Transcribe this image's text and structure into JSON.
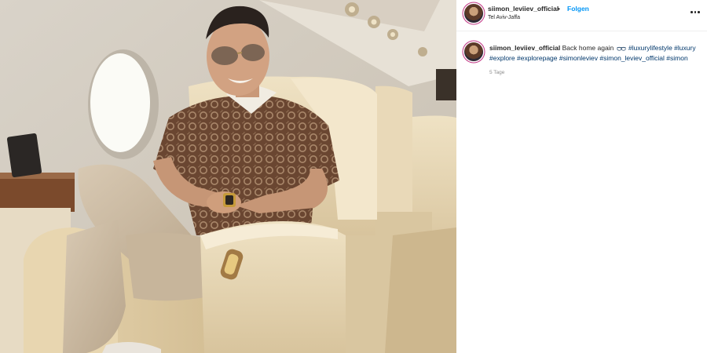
{
  "post": {
    "username": "siimon_leviiev_official",
    "separator": "•",
    "follow_label": "Folgen",
    "location": "Tel Aviv-Jaffa",
    "more_icon": "more-horizontal-icon"
  },
  "caption": {
    "username": "siimon_leviiev_official",
    "text": "Back home again",
    "emoji_icon": "sunglasses-emoji",
    "hashtags": [
      "#luxurylifestyle",
      "#luxury",
      "#explore",
      "#explorepage",
      "#simonleviev",
      "#simon_leviev_official",
      "#simon"
    ],
    "time": "5 Tage"
  },
  "colors": {
    "link_blue": "#0095f6",
    "hashtag_blue": "#00376b",
    "muted": "#8e8e8e"
  }
}
